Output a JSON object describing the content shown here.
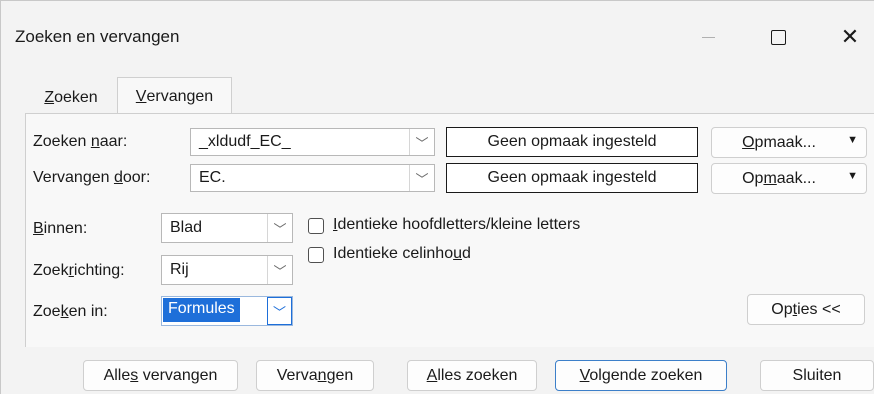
{
  "window": {
    "title": "Zoeken en vervangen",
    "icons": {
      "minimize": "minimize-icon",
      "maximize": "maximize-icon",
      "close": "close-icon"
    }
  },
  "tabs": [
    {
      "label_pre": "",
      "label_key": "Z",
      "label_post": "oeken"
    },
    {
      "label_pre": "",
      "label_key": "V",
      "label_post": "ervangen",
      "active": true
    }
  ],
  "fields": {
    "find": {
      "label_pre": "Zoeken ",
      "label_key": "n",
      "label_post": "aar:",
      "value": "_xldudf_EC_",
      "format_status": "Geen opmaak ingesteld",
      "format_btn_pre": "",
      "format_btn_key": "O",
      "format_btn_post": "pmaak..."
    },
    "replace": {
      "label_pre": "Vervangen ",
      "label_key": "d",
      "label_post": "oor:",
      "value": "EC.",
      "format_status": "Geen opmaak ingesteld",
      "format_btn_pre": "Op",
      "format_btn_key": "m",
      "format_btn_post": "aak..."
    }
  },
  "options": {
    "within": {
      "label_pre": "",
      "label_key": "B",
      "label_post": "innen:",
      "value": "Blad"
    },
    "direction": {
      "label_pre": "Zoek",
      "label_key": "r",
      "label_post": "ichting:",
      "value": "Rij"
    },
    "lookin": {
      "label_pre": "Zoe",
      "label_key": "k",
      "label_post": "en in:",
      "value": "Formules"
    },
    "match_case": {
      "label_pre": "",
      "label_key": "I",
      "label_post": "dentieke hoofdletters/kleine letters",
      "checked": false
    },
    "match_cell": {
      "label_pre": "Identieke celinho",
      "label_key": "u",
      "label_post": "d",
      "checked": false
    },
    "options_btn": {
      "label_pre": "Op",
      "label_key": "t",
      "label_post": "ies <<"
    }
  },
  "buttons": {
    "replace_all": {
      "pre": "Alle",
      "key": "s",
      "post": " vervangen"
    },
    "replace": {
      "pre": "Verva",
      "key": "n",
      "post": "gen"
    },
    "find_all": {
      "pre": "",
      "key": "A",
      "post": "lles zoeken"
    },
    "find_next": {
      "pre": "",
      "key": "V",
      "post": "olgende zoeken"
    },
    "close": {
      "pre": "Sluiten",
      "key": "",
      "post": ""
    }
  }
}
